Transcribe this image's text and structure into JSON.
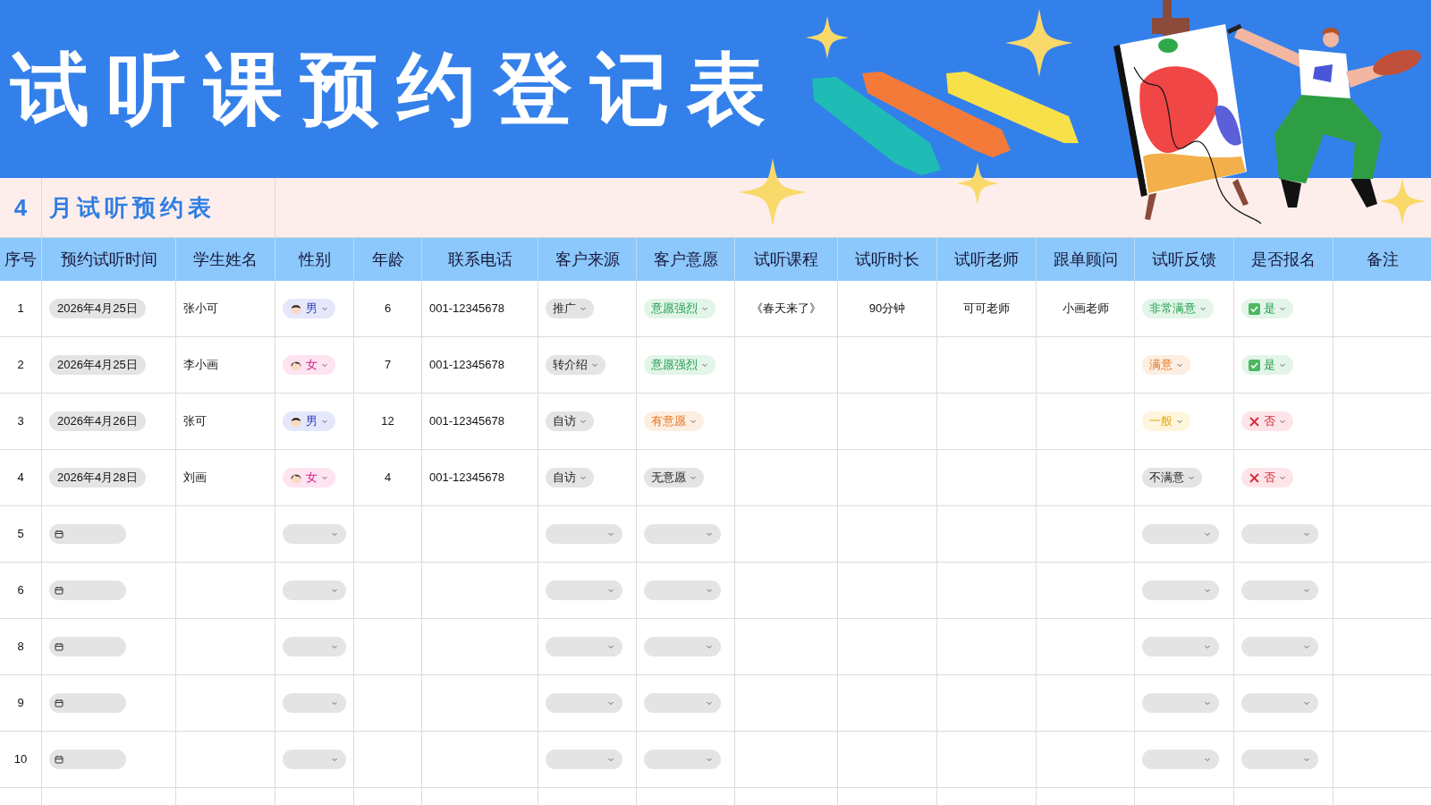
{
  "banner": {
    "title": "试听课预约登记表"
  },
  "subtitle": {
    "month": "4",
    "text": "月试听预约表"
  },
  "table": {
    "columns": [
      "序号",
      "预约试听时间",
      "学生姓名",
      "性别",
      "年龄",
      "联系电话",
      "客户来源",
      "客户意愿",
      "试听课程",
      "试听时长",
      "试听老师",
      "跟单顾问",
      "试听反馈",
      "是否报名",
      "备注"
    ],
    "rows": [
      {
        "no": "1",
        "date": "2026年4月25日",
        "name": "张小可",
        "gender": {
          "label": "男",
          "kind": "male"
        },
        "age": "6",
        "phone": "001-12345678",
        "source": "推广",
        "intent": {
          "label": "意愿强烈",
          "kind": "strong"
        },
        "course": "《春天来了》",
        "duration": "90分钟",
        "teacher": "可可老师",
        "advisor": "小画老师",
        "feedback": {
          "label": "非常满意",
          "kind": "very_good"
        },
        "enrolled": {
          "label": "是",
          "checked": true
        }
      },
      {
        "no": "2",
        "date": "2026年4月25日",
        "name": "李小画",
        "gender": {
          "label": "女",
          "kind": "female"
        },
        "age": "7",
        "phone": "001-12345678",
        "source": "转介绍",
        "intent": {
          "label": "意愿强烈",
          "kind": "strong"
        },
        "feedback": {
          "label": "满意",
          "kind": "good"
        },
        "enrolled": {
          "label": "是",
          "checked": true
        }
      },
      {
        "no": "3",
        "date": "2026年4月26日",
        "name": "张可",
        "gender": {
          "label": "男",
          "kind": "male"
        },
        "age": "12",
        "phone": "001-12345678",
        "source": "自访",
        "intent": {
          "label": "有意愿",
          "kind": "some"
        },
        "feedback": {
          "label": "一般",
          "kind": "neutral"
        },
        "enrolled": {
          "label": "否",
          "checked": false
        }
      },
      {
        "no": "4",
        "date": "2026年4月28日",
        "name": "刘画",
        "gender": {
          "label": "女",
          "kind": "female"
        },
        "age": "4",
        "phone": "001-12345678",
        "source": "自访",
        "intent": {
          "label": "无意愿",
          "kind": "none"
        },
        "feedback": {
          "label": "不满意",
          "kind": "bad"
        },
        "enrolled": {
          "label": "否",
          "checked": false
        }
      },
      {
        "no": "5"
      },
      {
        "no": "6"
      },
      {
        "no": "8"
      },
      {
        "no": "9"
      },
      {
        "no": "10"
      }
    ]
  }
}
